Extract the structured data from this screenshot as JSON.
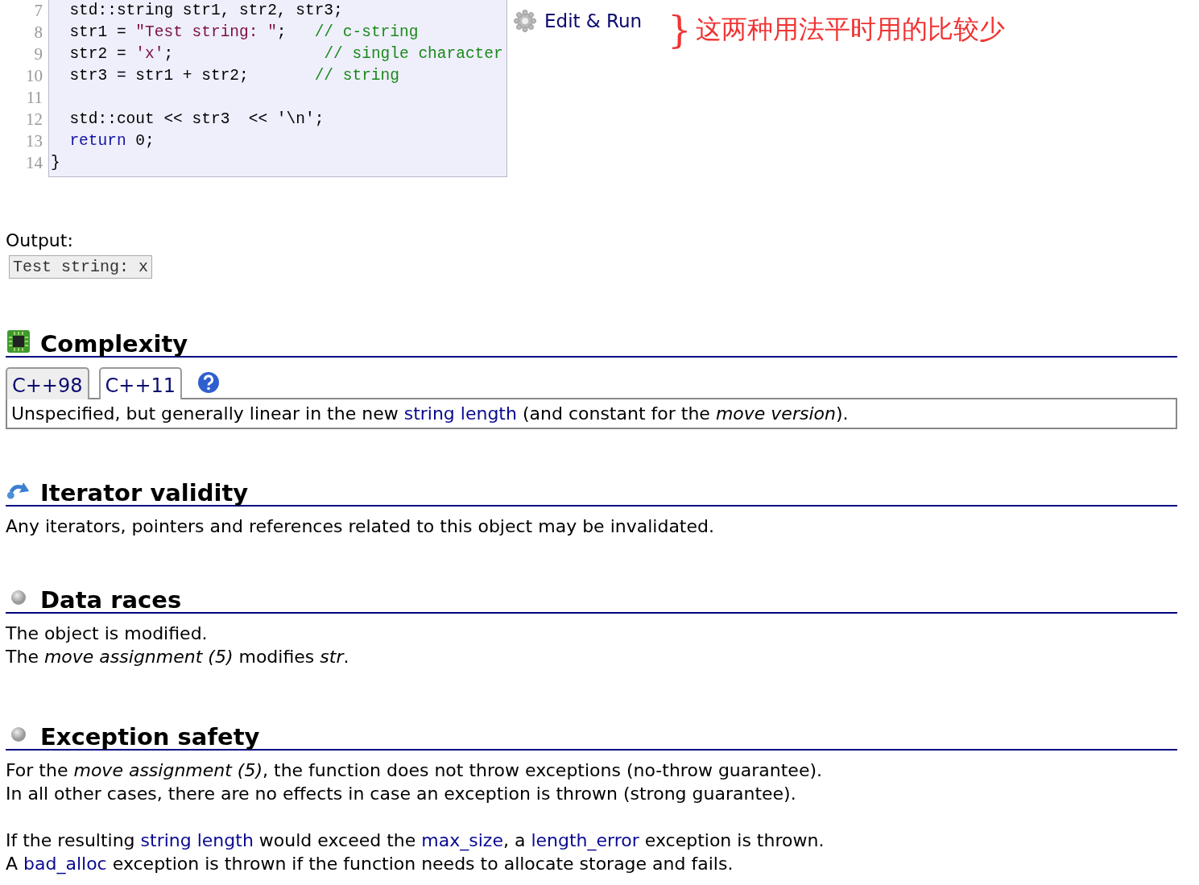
{
  "code": {
    "lines": [
      {
        "number": "7",
        "tokens": [
          {
            "kind": "plain",
            "text": "  std::string str1, str2, str3;"
          }
        ]
      },
      {
        "number": "8",
        "tokens": [
          {
            "kind": "plain",
            "text": "  str1 = "
          },
          {
            "kind": "string",
            "text": "\"Test string: \""
          },
          {
            "kind": "plain",
            "text": ";   "
          },
          {
            "kind": "comment",
            "text": "// c-string"
          }
        ]
      },
      {
        "number": "9",
        "tokens": [
          {
            "kind": "plain",
            "text": "  str2 = "
          },
          {
            "kind": "string",
            "text": "'x'"
          },
          {
            "kind": "plain",
            "text": ";                "
          },
          {
            "kind": "comment",
            "text": "// single character"
          }
        ]
      },
      {
        "number": "10",
        "tokens": [
          {
            "kind": "plain",
            "text": "  str3 = str1 + str2;       "
          },
          {
            "kind": "comment",
            "text": "// string"
          }
        ]
      },
      {
        "number": "11"
      },
      {
        "number": "12",
        "tokens": [
          {
            "kind": "plain",
            "text": "  std::cout << str3  << '\\n';"
          }
        ]
      },
      {
        "number": "13",
        "tokens": [
          {
            "kind": "keyword",
            "text": "  return"
          },
          {
            "kind": "plain",
            "text": " 0;"
          }
        ]
      },
      {
        "number": "14",
        "tokens": [
          {
            "kind": "plain",
            "text": "}"
          }
        ]
      }
    ]
  },
  "edit_run": "Edit & Run",
  "annotation": {
    "brace": "}",
    "text": "这两种用法平时用的比较少"
  },
  "output": {
    "label": "Output:",
    "text": "Test string: x"
  },
  "sections": [
    {
      "title": "Complexity",
      "tabs": [
        {
          "label": "C++98",
          "selected": false
        },
        {
          "label": "C++11",
          "selected": true
        }
      ],
      "paragraphs": [
        {
          "lines": [
            {
              "parts": [
                {
                  "kind": "text",
                  "text": "Unspecified, but generally linear in the new "
                },
                {
                  "kind": "link",
                  "text": "string length"
                },
                {
                  "kind": "text",
                  "text": " (and constant for the *move version*)."
                }
              ]
            }
          ]
        }
      ]
    },
    {
      "title": "Iterator validity",
      "paragraphs": [
        {
          "lines": [
            {
              "parts": [
                {
                  "kind": "text",
                  "text": "Any iterators, pointers and references related to this object may be invalidated."
                }
              ]
            }
          ]
        }
      ]
    },
    {
      "title": "Data races",
      "paragraphs": [
        {
          "lines": [
            {
              "parts": [
                {
                  "kind": "text",
                  "text": "The object is modified."
                }
              ]
            },
            {
              "parts": [
                {
                  "kind": "text",
                  "text": "The *move assignment (5)* modifies *str*."
                }
              ]
            }
          ]
        }
      ]
    },
    {
      "title": "Exception safety",
      "paragraphs": [
        {
          "lines": [
            {
              "parts": [
                {
                  "kind": "text",
                  "text": "For the *move assignment (5)*, the function does not throw exceptions (no-throw guarantee)."
                }
              ]
            },
            {
              "parts": [
                {
                  "kind": "text",
                  "text": "In all other cases, there are no effects in case an exception is thrown (strong guarantee)."
                }
              ]
            }
          ]
        },
        {
          "lines": [
            {
              "parts": [
                {
                  "kind": "text",
                  "text": "If the resulting "
                },
                {
                  "kind": "link",
                  "text": "string length"
                },
                {
                  "kind": "text",
                  "text": " would exceed the "
                },
                {
                  "kind": "link",
                  "text": "max_size"
                },
                {
                  "kind": "text",
                  "text": ", a "
                },
                {
                  "kind": "link",
                  "text": "length_error"
                },
                {
                  "kind": "text",
                  "text": " exception is thrown."
                }
              ]
            },
            {
              "parts": [
                {
                  "kind": "text",
                  "text": "A "
                },
                {
                  "kind": "link",
                  "text": "bad_alloc"
                },
                {
                  "kind": "text",
                  "text": " exception is thrown if the function needs to allocate storage and fails."
                }
              ]
            }
          ]
        }
      ]
    }
  ]
}
